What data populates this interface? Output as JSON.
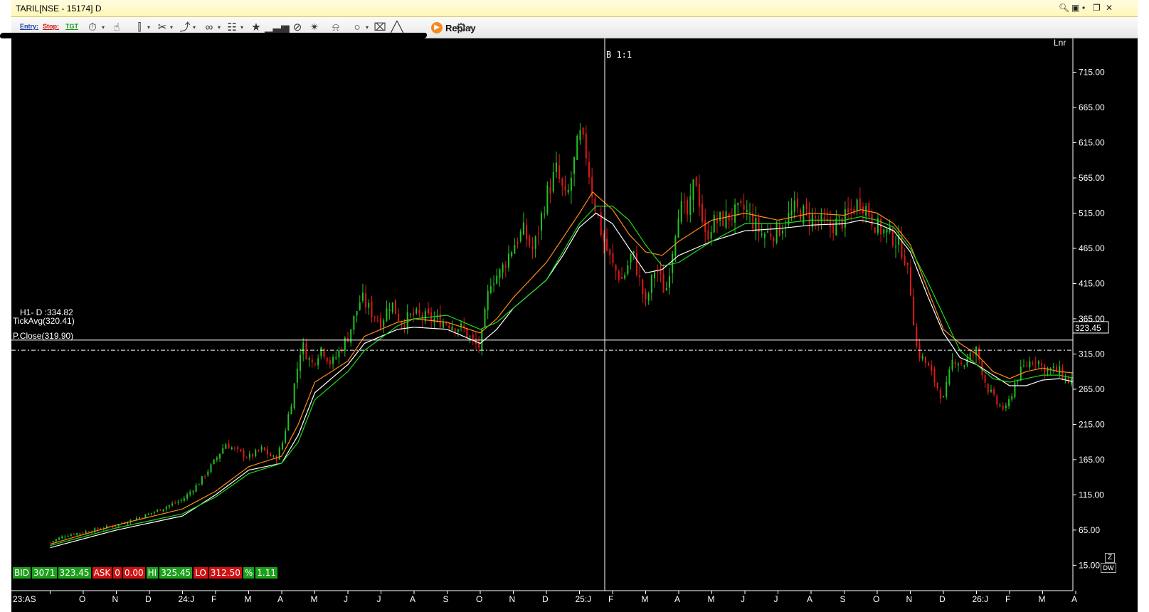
{
  "window": {
    "title": "TARIL[NSE - 15174] D"
  },
  "toolbar": {
    "entry_label": "Entry:",
    "stop_label": "Stop:",
    "tgt_label": "TGT",
    "replay_label": "Replay",
    "icons": [
      "clock-icon",
      "cursor-icon",
      "candle-type-icon",
      "drawing-tools-icon",
      "measure-icon",
      "link-icon",
      "book-icon",
      "star-icon",
      "bar-chart-icon",
      "compare-icon",
      "pointer-icon",
      "alert-bell-icon",
      "zoom-icon",
      "trash-icon",
      "line-chart-icon",
      "replay-icon",
      "settings-gear-icon"
    ]
  },
  "chart": {
    "scale_label": "Lnr",
    "crosshair_label": "B 1:1",
    "h1_label": "H1- D :334.82",
    "tickavg_label": "TickAvg(320.41)",
    "pclose_label": "P.Close(319.90)",
    "last_price_badge": "323.45",
    "colors": {
      "background": "#000000",
      "up": "#22c322",
      "down": "#e01818",
      "ma_white": "#ffffff",
      "ma_orange": "#ff8c1a",
      "ma_green": "#1ed81e"
    }
  },
  "quote_bar": {
    "bid_label": "BID",
    "bid_qty": "3071",
    "bid_price": "323.45",
    "ask_label": "ASK",
    "ask_qty": "0",
    "ask_price": "0.00",
    "hi_label": "HI",
    "hi_value": "325.45",
    "lo_label": "LO",
    "lo_value": "312.50",
    "pct_label": "%",
    "pct_value": "1.11"
  },
  "axis_corner": {
    "z_label": "Z",
    "dw_label": "DW"
  },
  "chart_data": {
    "type": "candlestick",
    "y_scale": "linear",
    "ylim": [
      -35,
      755
    ],
    "yticks": [
      "715.00",
      "665.00",
      "615.00",
      "565.00",
      "515.00",
      "465.00",
      "415.00",
      "365.00",
      "315.00",
      "265.00",
      "215.00",
      "165.00",
      "115.00",
      "65.00",
      "15.00"
    ],
    "xtick_labels": [
      "23:AS",
      "O",
      "N",
      "D",
      "24:J",
      "F",
      "M",
      "A",
      "M",
      "J",
      "J",
      "A",
      "S",
      "O",
      "N",
      "D",
      "25:J",
      "F",
      "M",
      "A",
      "M",
      "J",
      "J",
      "A",
      "S",
      "O",
      "N",
      "D",
      "26:J",
      "F",
      "M",
      "A"
    ],
    "close_anchors": [
      {
        "m": 0.0,
        "v": 48
      },
      {
        "m": 0.5,
        "v": 58
      },
      {
        "m": 1.0,
        "v": 62
      },
      {
        "m": 2.0,
        "v": 72
      },
      {
        "m": 3.0,
        "v": 88
      },
      {
        "m": 3.5,
        "v": 98
      },
      {
        "m": 4.0,
        "v": 108
      },
      {
        "m": 4.5,
        "v": 132
      },
      {
        "m": 5.0,
        "v": 165
      },
      {
        "m": 5.3,
        "v": 188
      },
      {
        "m": 5.6,
        "v": 178
      },
      {
        "m": 6.0,
        "v": 168
      },
      {
        "m": 6.4,
        "v": 180
      },
      {
        "m": 6.8,
        "v": 165
      },
      {
        "m": 7.0,
        "v": 185
      },
      {
        "m": 7.3,
        "v": 250
      },
      {
        "m": 7.6,
        "v": 330
      },
      {
        "m": 7.9,
        "v": 300
      },
      {
        "m": 8.2,
        "v": 325
      },
      {
        "m": 8.5,
        "v": 300
      },
      {
        "m": 9.0,
        "v": 340
      },
      {
        "m": 9.4,
        "v": 395
      },
      {
        "m": 9.7,
        "v": 375
      },
      {
        "m": 10.0,
        "v": 360
      },
      {
        "m": 10.3,
        "v": 390
      },
      {
        "m": 10.6,
        "v": 360
      },
      {
        "m": 11.0,
        "v": 370
      },
      {
        "m": 11.5,
        "v": 365
      },
      {
        "m": 12.0,
        "v": 360
      },
      {
        "m": 12.5,
        "v": 350
      },
      {
        "m": 12.8,
        "v": 330
      },
      {
        "m": 13.0,
        "v": 325
      },
      {
        "m": 13.3,
        "v": 420
      },
      {
        "m": 13.6,
        "v": 430
      },
      {
        "m": 14.0,
        "v": 470
      },
      {
        "m": 14.3,
        "v": 490
      },
      {
        "m": 14.6,
        "v": 460
      },
      {
        "m": 15.0,
        "v": 540
      },
      {
        "m": 15.3,
        "v": 575
      },
      {
        "m": 15.6,
        "v": 530
      },
      {
        "m": 16.0,
        "v": 625
      },
      {
        "m": 16.2,
        "v": 600
      },
      {
        "m": 16.4,
        "v": 540
      },
      {
        "m": 16.7,
        "v": 480
      },
      {
        "m": 17.0,
        "v": 440
      },
      {
        "m": 17.3,
        "v": 420
      },
      {
        "m": 17.6,
        "v": 460
      },
      {
        "m": 18.0,
        "v": 385
      },
      {
        "m": 18.3,
        "v": 440
      },
      {
        "m": 18.6,
        "v": 400
      },
      {
        "m": 19.0,
        "v": 525
      },
      {
        "m": 19.3,
        "v": 510
      },
      {
        "m": 19.5,
        "v": 570
      },
      {
        "m": 19.8,
        "v": 480
      },
      {
        "m": 20.0,
        "v": 500
      },
      {
        "m": 20.5,
        "v": 510
      },
      {
        "m": 21.0,
        "v": 520
      },
      {
        "m": 21.5,
        "v": 485
      },
      {
        "m": 22.0,
        "v": 490
      },
      {
        "m": 22.5,
        "v": 520
      },
      {
        "m": 23.0,
        "v": 510
      },
      {
        "m": 23.5,
        "v": 495
      },
      {
        "m": 24.0,
        "v": 505
      },
      {
        "m": 24.5,
        "v": 535
      },
      {
        "m": 25.0,
        "v": 495
      },
      {
        "m": 25.5,
        "v": 480
      },
      {
        "m": 25.8,
        "v": 460
      },
      {
        "m": 26.0,
        "v": 410
      },
      {
        "m": 26.2,
        "v": 320
      },
      {
        "m": 26.5,
        "v": 300
      },
      {
        "m": 27.0,
        "v": 250
      },
      {
        "m": 27.3,
        "v": 310
      },
      {
        "m": 27.6,
        "v": 300
      },
      {
        "m": 28.0,
        "v": 320
      },
      {
        "m": 28.3,
        "v": 270
      },
      {
        "m": 28.6,
        "v": 245
      },
      {
        "m": 28.9,
        "v": 235
      },
      {
        "m": 29.2,
        "v": 280
      },
      {
        "m": 29.5,
        "v": 300
      },
      {
        "m": 29.8,
        "v": 310
      },
      {
        "m": 30.0,
        "v": 295
      },
      {
        "m": 30.5,
        "v": 290
      },
      {
        "m": 30.8,
        "v": 275
      },
      {
        "m": 31.0,
        "v": 285
      },
      {
        "m": 31.3,
        "v": 305
      },
      {
        "m": 31.5,
        "v": 323
      }
    ],
    "ma_white_anchors": [
      {
        "m": 0,
        "v": 40
      },
      {
        "m": 2,
        "v": 65
      },
      {
        "m": 4,
        "v": 85
      },
      {
        "m": 5,
        "v": 115
      },
      {
        "m": 6,
        "v": 150
      },
      {
        "m": 7,
        "v": 160
      },
      {
        "m": 7.5,
        "v": 200
      },
      {
        "m": 8,
        "v": 260
      },
      {
        "m": 9,
        "v": 300
      },
      {
        "m": 9.5,
        "v": 330
      },
      {
        "m": 10.5,
        "v": 350
      },
      {
        "m": 11,
        "v": 353
      },
      {
        "m": 12,
        "v": 350
      },
      {
        "m": 13,
        "v": 330
      },
      {
        "m": 13.5,
        "v": 350
      },
      {
        "m": 14,
        "v": 380
      },
      {
        "m": 14.5,
        "v": 400
      },
      {
        "m": 15,
        "v": 420
      },
      {
        "m": 15.5,
        "v": 455
      },
      {
        "m": 16,
        "v": 495
      },
      {
        "m": 16.5,
        "v": 515
      },
      {
        "m": 17,
        "v": 500
      },
      {
        "m": 17.5,
        "v": 465
      },
      {
        "m": 18,
        "v": 430
      },
      {
        "m": 18.5,
        "v": 435
      },
      {
        "m": 19,
        "v": 455
      },
      {
        "m": 20,
        "v": 475
      },
      {
        "m": 21,
        "v": 490
      },
      {
        "m": 22,
        "v": 493
      },
      {
        "m": 23,
        "v": 498
      },
      {
        "m": 24,
        "v": 500
      },
      {
        "m": 24.5,
        "v": 505
      },
      {
        "m": 25,
        "v": 500
      },
      {
        "m": 25.5,
        "v": 490
      },
      {
        "m": 26,
        "v": 460
      },
      {
        "m": 26.5,
        "v": 400
      },
      {
        "m": 27,
        "v": 345
      },
      {
        "m": 27.5,
        "v": 310
      },
      {
        "m": 28,
        "v": 300
      },
      {
        "m": 28.5,
        "v": 285
      },
      {
        "m": 29,
        "v": 270
      },
      {
        "m": 29.5,
        "v": 270
      },
      {
        "m": 30,
        "v": 278
      },
      {
        "m": 30.5,
        "v": 280
      },
      {
        "m": 31,
        "v": 275
      },
      {
        "m": 31.5,
        "v": 290
      }
    ],
    "ma_orange_anchors": [
      {
        "m": 0,
        "v": 45
      },
      {
        "m": 2,
        "v": 72
      },
      {
        "m": 4,
        "v": 95
      },
      {
        "m": 5,
        "v": 120
      },
      {
        "m": 6,
        "v": 155
      },
      {
        "m": 7,
        "v": 170
      },
      {
        "m": 7.5,
        "v": 215
      },
      {
        "m": 8,
        "v": 275
      },
      {
        "m": 9,
        "v": 305
      },
      {
        "m": 9.5,
        "v": 340
      },
      {
        "m": 10.5,
        "v": 360
      },
      {
        "m": 11,
        "v": 365
      },
      {
        "m": 12,
        "v": 360
      },
      {
        "m": 13,
        "v": 345
      },
      {
        "m": 13.5,
        "v": 365
      },
      {
        "m": 14,
        "v": 395
      },
      {
        "m": 14.5,
        "v": 420
      },
      {
        "m": 15,
        "v": 445
      },
      {
        "m": 15.5,
        "v": 480
      },
      {
        "m": 16,
        "v": 515
      },
      {
        "m": 16.4,
        "v": 545
      },
      {
        "m": 17,
        "v": 520
      },
      {
        "m": 17.5,
        "v": 485
      },
      {
        "m": 18,
        "v": 460
      },
      {
        "m": 18.5,
        "v": 455
      },
      {
        "m": 19,
        "v": 475
      },
      {
        "m": 20,
        "v": 505
      },
      {
        "m": 21,
        "v": 515
      },
      {
        "m": 22,
        "v": 505
      },
      {
        "m": 23,
        "v": 515
      },
      {
        "m": 24,
        "v": 512
      },
      {
        "m": 24.5,
        "v": 520
      },
      {
        "m": 25,
        "v": 515
      },
      {
        "m": 25.5,
        "v": 500
      },
      {
        "m": 26,
        "v": 470
      },
      {
        "m": 26.5,
        "v": 410
      },
      {
        "m": 27,
        "v": 350
      },
      {
        "m": 27.5,
        "v": 330
      },
      {
        "m": 28,
        "v": 315
      },
      {
        "m": 28.5,
        "v": 290
      },
      {
        "m": 29,
        "v": 280
      },
      {
        "m": 29.5,
        "v": 290
      },
      {
        "m": 30,
        "v": 295
      },
      {
        "m": 30.5,
        "v": 290
      },
      {
        "m": 31,
        "v": 288
      },
      {
        "m": 31.5,
        "v": 305
      }
    ],
    "ma_green_anchors": [
      {
        "m": 0,
        "v": 43
      },
      {
        "m": 2,
        "v": 68
      },
      {
        "m": 4,
        "v": 88
      },
      {
        "m": 5,
        "v": 112
      },
      {
        "m": 6,
        "v": 145
      },
      {
        "m": 7,
        "v": 160
      },
      {
        "m": 7.5,
        "v": 190
      },
      {
        "m": 8,
        "v": 250
      },
      {
        "m": 9,
        "v": 290
      },
      {
        "m": 9.5,
        "v": 320
      },
      {
        "m": 10.5,
        "v": 355
      },
      {
        "m": 11,
        "v": 365
      },
      {
        "m": 12,
        "v": 370
      },
      {
        "m": 13,
        "v": 350
      },
      {
        "m": 13.5,
        "v": 360
      },
      {
        "m": 14,
        "v": 380
      },
      {
        "m": 14.5,
        "v": 400
      },
      {
        "m": 15,
        "v": 420
      },
      {
        "m": 15.5,
        "v": 460
      },
      {
        "m": 16,
        "v": 500
      },
      {
        "m": 16.5,
        "v": 525
      },
      {
        "m": 17,
        "v": 525
      },
      {
        "m": 17.5,
        "v": 505
      },
      {
        "m": 18,
        "v": 470
      },
      {
        "m": 18.5,
        "v": 440
      },
      {
        "m": 19,
        "v": 445
      },
      {
        "m": 20,
        "v": 475
      },
      {
        "m": 21,
        "v": 500
      },
      {
        "m": 22,
        "v": 500
      },
      {
        "m": 23,
        "v": 505
      },
      {
        "m": 24,
        "v": 505
      },
      {
        "m": 24.5,
        "v": 510
      },
      {
        "m": 25,
        "v": 505
      },
      {
        "m": 25.5,
        "v": 495
      },
      {
        "m": 26,
        "v": 465
      },
      {
        "m": 26.5,
        "v": 420
      },
      {
        "m": 27,
        "v": 370
      },
      {
        "m": 27.5,
        "v": 320
      },
      {
        "m": 28,
        "v": 300
      },
      {
        "m": 28.5,
        "v": 280
      },
      {
        "m": 29,
        "v": 275
      },
      {
        "m": 29.5,
        "v": 280
      },
      {
        "m": 30,
        "v": 285
      },
      {
        "m": 30.5,
        "v": 285
      },
      {
        "m": 31,
        "v": 280
      },
      {
        "m": 31.5,
        "v": 295
      }
    ],
    "h1_value": 334.82,
    "tickavg_value": 320.41,
    "last_price": 323.45
  }
}
